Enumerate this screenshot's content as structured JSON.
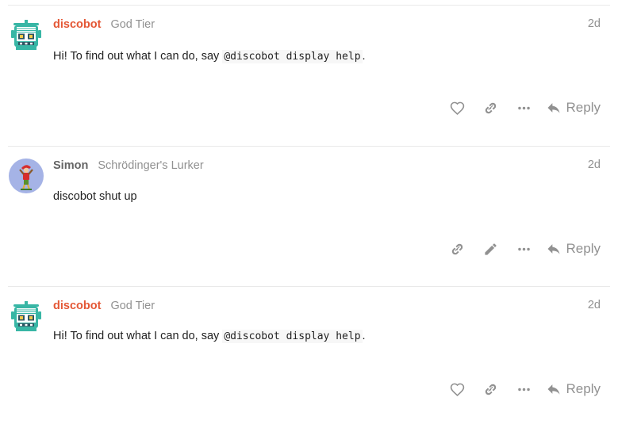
{
  "posts": [
    {
      "username": "discobot",
      "user_title": "God Tier",
      "date": "2d",
      "body_text": "Hi! To find out what I can do, say ",
      "body_code": "@discobot display help",
      "body_end": ".",
      "avatar_icon": "robot-avatar-icon",
      "actions": [
        "like-icon",
        "link-icon",
        "more-icon"
      ],
      "reply_label": "Reply"
    },
    {
      "username": "Simon",
      "user_title": "Schrödinger's Lurker",
      "date": "2d",
      "body_text": "discobot shut up",
      "avatar_icon": "user-avatar-icon",
      "actions": [
        "link-icon",
        "edit-icon",
        "more-icon"
      ],
      "reply_label": "Reply"
    },
    {
      "username": "discobot",
      "user_title": "God Tier",
      "date": "2d",
      "body_text": "Hi! To find out what I can do, say ",
      "body_code": "@discobot display help",
      "body_end": ".",
      "avatar_icon": "robot-avatar-icon",
      "actions": [
        "like-icon",
        "link-icon",
        "more-icon"
      ],
      "reply_label": "Reply"
    }
  ],
  "colors": {
    "staff_name": "#e45735",
    "user_name": "#646464",
    "muted": "#919191",
    "robot_teal": "#38b6a5",
    "avatar_bg": "#a5b3e6"
  }
}
